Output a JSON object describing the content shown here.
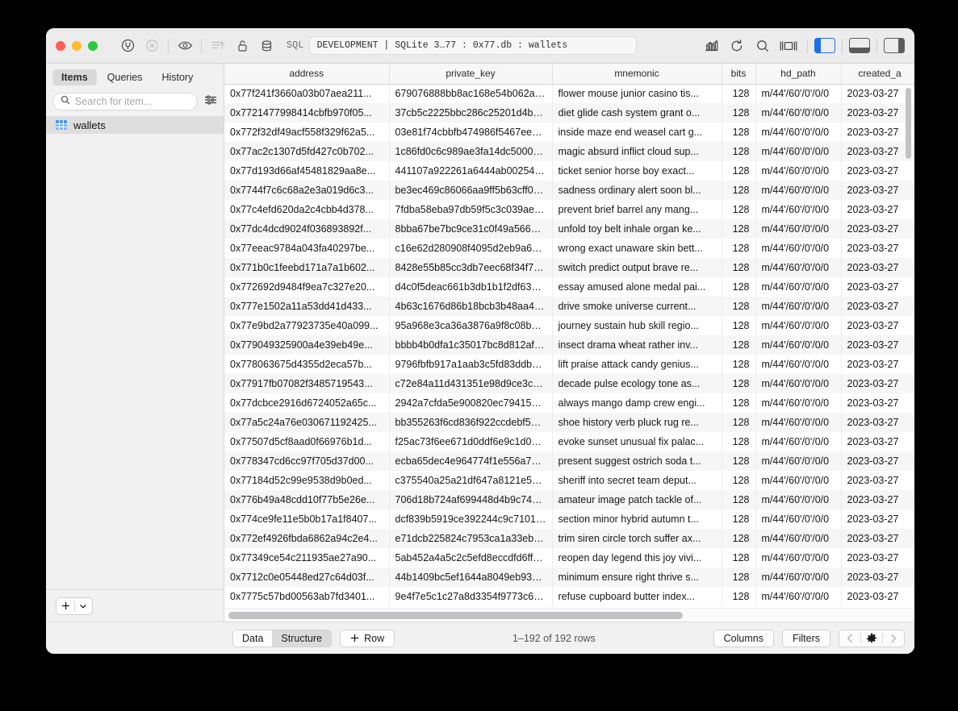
{
  "window": {
    "title_field": "DEVELOPMENT | SQLite 3…77 : 0x77.db : wallets",
    "sql_label": "SQL",
    "accent_color": "#1f6feb",
    "traffic_lights": [
      "close-red",
      "minimize-yellow",
      "zoom-green"
    ]
  },
  "toolbar": {
    "left_icons": [
      {
        "name": "connect-icon",
        "label": "Connect"
      },
      {
        "name": "stop-icon",
        "label": "Stop"
      },
      {
        "name": "eye-icon",
        "label": "Preview"
      },
      {
        "name": "sort-lines-icon",
        "label": "Sort"
      },
      {
        "name": "unlock-icon",
        "label": "Unlock"
      },
      {
        "name": "database-icon",
        "label": "Database"
      }
    ],
    "right_icons": [
      {
        "name": "chart-icon",
        "label": "Charts"
      },
      {
        "name": "refresh-icon",
        "label": "Refresh"
      },
      {
        "name": "search-icon",
        "label": "Search"
      },
      {
        "name": "split-view-icon",
        "label": "Split View"
      }
    ],
    "panel_toggles": [
      {
        "name": "left-panel-toggle",
        "label": "Left Panel",
        "active": true
      },
      {
        "name": "bottom-panel-toggle",
        "label": "Bottom Panel",
        "active": false
      },
      {
        "name": "right-panel-toggle",
        "label": "Right Panel",
        "active": false
      }
    ]
  },
  "sidebar": {
    "tabs": [
      {
        "label": "Items",
        "active": true
      },
      {
        "label": "Queries",
        "active": false
      },
      {
        "label": "History",
        "active": false
      }
    ],
    "search": {
      "value": "",
      "placeholder": "Search for item..."
    },
    "items": [
      {
        "label": "wallets",
        "icon": "table-icon",
        "selected": true
      }
    ],
    "footer": {
      "add_label": "+",
      "chevron": "⌄"
    }
  },
  "table": {
    "columns": [
      {
        "key": "address",
        "label": "address"
      },
      {
        "key": "private_key",
        "label": "private_key"
      },
      {
        "key": "mnemonic",
        "label": "mnemonic"
      },
      {
        "key": "bits",
        "label": "bits"
      },
      {
        "key": "hd_path",
        "label": "hd_path"
      },
      {
        "key": "created_at",
        "label": "created_a"
      }
    ],
    "rows": [
      [
        "0x77f241f3660a03b07aea211...",
        "679076888bb8ac168e54b062a918...",
        "flower mouse junior casino tis...",
        "128",
        "m/44'/60'/0'/0/0",
        "2023-03-27"
      ],
      [
        "0x7721477998414cbfb970f05...",
        "37cb5c2225bbc286c25201d4be966...",
        "diet glide cash system grant o...",
        "128",
        "m/44'/60'/0'/0/0",
        "2023-03-27"
      ],
      [
        "0x772f32df49acf558f329f62a5...",
        "03e81f74cbbfb474986f5467ee99cb...",
        "inside maze end weasel cart g...",
        "128",
        "m/44'/60'/0'/0/0",
        "2023-03-27"
      ],
      [
        "0x77ac2c1307d5fd427c0b702...",
        "1c86fd0c6c989ae3fa14dc500062b2...",
        "magic absurd inflict cloud sup...",
        "128",
        "m/44'/60'/0'/0/0",
        "2023-03-27"
      ],
      [
        "0x77d193d66af45481829aa8e...",
        "441107a922261a6444ab00254191...",
        "ticket senior horse boy exact...",
        "128",
        "m/44'/60'/0'/0/0",
        "2023-03-27"
      ],
      [
        "0x7744f7c6c68a2e3a019d6c3...",
        "be3ec469c86066aa9ff5b63cff0773...",
        "sadness ordinary alert soon bl...",
        "128",
        "m/44'/60'/0'/0/0",
        "2023-03-27"
      ],
      [
        "0x77c4efd620da2c4cbb4d378...",
        "7fdba58eba97db59f5c3c039aeea67...",
        "prevent brief barrel any mang...",
        "128",
        "m/44'/60'/0'/0/0",
        "2023-03-27"
      ],
      [
        "0x77dc4dcd9024f036893892f...",
        "8bba67be7bc9ce31c0f49a566724b...",
        "unfold toy belt inhale organ ke...",
        "128",
        "m/44'/60'/0'/0/0",
        "2023-03-27"
      ],
      [
        "0x77eeac9784a043fa40297be...",
        "c16e62d280908f4095d2eb9a69401...",
        "wrong exact unaware skin bett...",
        "128",
        "m/44'/60'/0'/0/0",
        "2023-03-27"
      ],
      [
        "0x771b0c1feebd171a7a1b602...",
        "8428e55b85cc3db7eec68f34f7fccdf...",
        "switch predict output brave re...",
        "128",
        "m/44'/60'/0'/0/0",
        "2023-03-27"
      ],
      [
        "0x772692d9484f9ea7c327e20...",
        "d4c0f5deac661b3db1b1f2df635c6c...",
        "essay amused alone medal pai...",
        "128",
        "m/44'/60'/0'/0/0",
        "2023-03-27"
      ],
      [
        "0x777e1502a11a53dd41d433...",
        "4b63c1676d86b18bcb3b48aa492d1...",
        "drive smoke universe current...",
        "128",
        "m/44'/60'/0'/0/0",
        "2023-03-27"
      ],
      [
        "0x77e9bd2a77923735e40a099...",
        "95a968e3ca36a3876a9f8c08b947c...",
        "journey sustain hub skill regio...",
        "128",
        "m/44'/60'/0'/0/0",
        "2023-03-27"
      ],
      [
        "0x779049325900a4e39eb49e...",
        "bbbb4b0dfa1c35017bc8d812af2e5...",
        "insect drama wheat rather inv...",
        "128",
        "m/44'/60'/0'/0/0",
        "2023-03-27"
      ],
      [
        "0x778063675d4355d2eca57b...",
        "9796fbfb917a1aab3c5fd83ddb7ce1...",
        "lift praise attack candy genius...",
        "128",
        "m/44'/60'/0'/0/0",
        "2023-03-27"
      ],
      [
        "0x77917fb07082f3485719543...",
        "c72e84a11d431351e98d9ce3cb241...",
        "decade pulse ecology tone as...",
        "128",
        "m/44'/60'/0'/0/0",
        "2023-03-27"
      ],
      [
        "0x77dcbce2916d6724052a65c...",
        "2942a7cfda5e900820ec794155c1ff...",
        "always mango damp crew engi...",
        "128",
        "m/44'/60'/0'/0/0",
        "2023-03-27"
      ],
      [
        "0x77a5c24a76e030671192425...",
        "bb355263f6cd836f922ccdebf5d2f4...",
        "shoe history verb pluck rug re...",
        "128",
        "m/44'/60'/0'/0/0",
        "2023-03-27"
      ],
      [
        "0x77507d5cf8aad0f66976b1d...",
        "f25ac73f6ee671d0ddf6e9c1d0168f...",
        "evoke sunset unusual fix palac...",
        "128",
        "m/44'/60'/0'/0/0",
        "2023-03-27"
      ],
      [
        "0x778347cd6cc97f705d37d00...",
        "ecba65dec4e964774f1e556a7cd5d...",
        "present suggest ostrich soda t...",
        "128",
        "m/44'/60'/0'/0/0",
        "2023-03-27"
      ],
      [
        "0x77184d52c99e9538d9b0ed...",
        "c375540a25a21df647a8121e52f6a...",
        "sheriff into secret team deput...",
        "128",
        "m/44'/60'/0'/0/0",
        "2023-03-27"
      ],
      [
        "0x776b49a48cdd10f77b5e26e...",
        "706d18b724af699448d4b9c746752...",
        "amateur image patch tackle of...",
        "128",
        "m/44'/60'/0'/0/0",
        "2023-03-27"
      ],
      [
        "0x774ce9fe11e5b0b17a1f8407...",
        "dcf839b5919ce392244c9c7101539...",
        "section minor hybrid autumn t...",
        "128",
        "m/44'/60'/0'/0/0",
        "2023-03-27"
      ],
      [
        "0x772ef4926fbda6862a94c2e4...",
        "e71dcb225824c7953ca1a33ebb82c...",
        "trim siren circle torch suffer ax...",
        "128",
        "m/44'/60'/0'/0/0",
        "2023-03-27"
      ],
      [
        "0x77349ce54c211935ae27a90...",
        "5ab452a4a5c2c5efd8eccdfd6ff12d1...",
        "reopen day legend this joy vivi...",
        "128",
        "m/44'/60'/0'/0/0",
        "2023-03-27"
      ],
      [
        "0x7712c0e05448ed27c64d03f...",
        "44b1409bc5ef1644a8049eb939894...",
        "minimum ensure right thrive s...",
        "128",
        "m/44'/60'/0'/0/0",
        "2023-03-27"
      ],
      [
        "0x7775c57bd00563ab7fd3401...",
        "9e4f7e5c1c27a8d3354f9773c653fd...",
        "refuse cupboard butter index...",
        "128",
        "m/44'/60'/0'/0/0",
        "2023-03-27"
      ]
    ]
  },
  "bottombar": {
    "view_modes": [
      {
        "label": "Data",
        "active": true
      },
      {
        "label": "Structure",
        "active": false
      }
    ],
    "add_row_label": "Row",
    "add_row_plus": "+",
    "row_count": "1–192 of 192 rows",
    "columns_label": "Columns",
    "filters_label": "Filters",
    "pager": {
      "prev": "‹",
      "gear": "gear-icon",
      "next": "›"
    }
  }
}
